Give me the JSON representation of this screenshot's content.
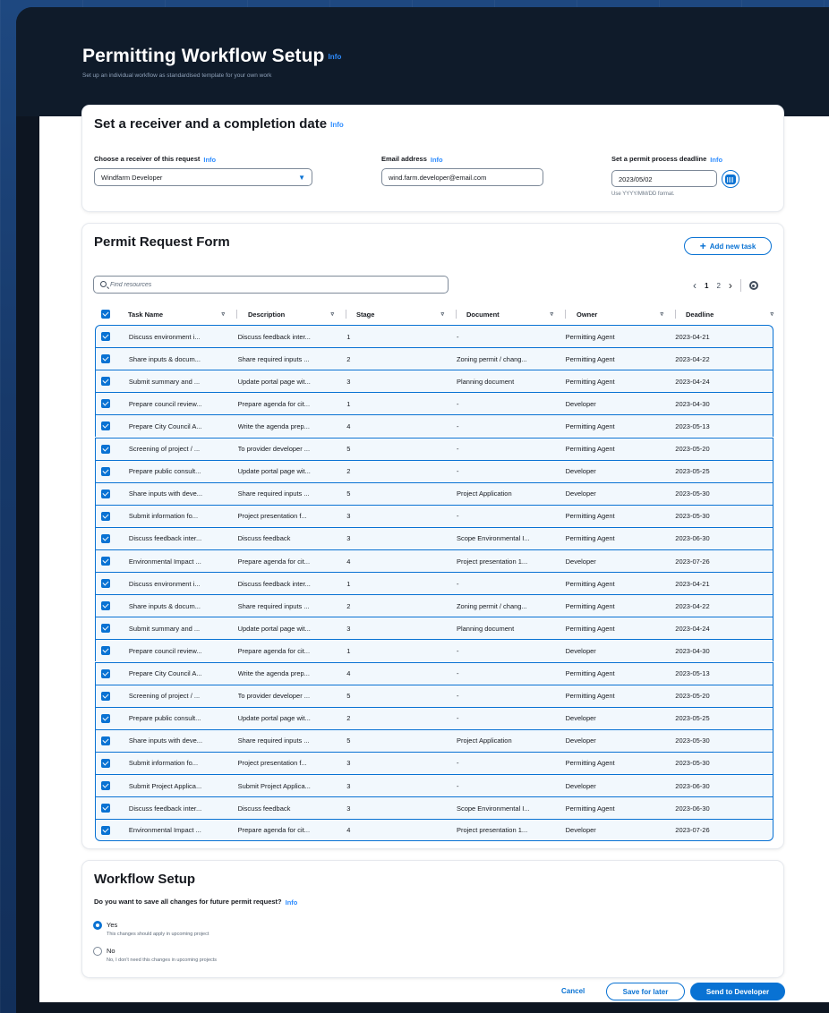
{
  "page": {
    "title": "Permitting Workflow Setup",
    "title_info": "Info",
    "subtitle": "Set up an individual workflow as standardised template for your own work"
  },
  "receiver_section": {
    "title": "Set a receiver and a completion date",
    "title_info": "Info",
    "receiver_label": "Choose a receiver of this request",
    "receiver_info": "Info",
    "receiver_value": "Windfarm Developer",
    "email_label": "Email address",
    "email_info": "Info",
    "email_value": "wind.farm.developer@email.com",
    "deadline_label": "Set a permit process deadline",
    "deadline_info": "Info",
    "deadline_value": "2023/05/02",
    "deadline_hint": "Use YYYY/MM/DD format."
  },
  "permit_form": {
    "title": "Permit Request Form",
    "add_task_label": "Add new task",
    "search_placeholder": "Find resources",
    "pagination": {
      "prev": "‹",
      "page1": "1",
      "page2": "2",
      "next": "›"
    },
    "columns": [
      "Task Name",
      "Description",
      "Stage",
      "Document",
      "Owner",
      "Deadline"
    ],
    "rows": [
      {
        "task": "Discuss environment i...",
        "desc": "Discuss feedback inter...",
        "stage": "1",
        "doc": "-",
        "owner": "Permitting Agent",
        "deadline": "2023-04-21"
      },
      {
        "task": "Share inputs & docum...",
        "desc": "Share required inputs ...",
        "stage": "2",
        "doc": "Zoning permit / chang...",
        "owner": "Permitting Agent",
        "deadline": "2023-04-22"
      },
      {
        "task": "Submit summary and ...",
        "desc": "Update portal page wit...",
        "stage": "3",
        "doc": "Planning document",
        "owner": "Permitting Agent",
        "deadline": "2023-04-24"
      },
      {
        "task": "Prepare council review...",
        "desc": "Prepare agenda for cit...",
        "stage": "1",
        "doc": "-",
        "owner": "Developer",
        "deadline": "2023-04-30"
      },
      {
        "task": "Prepare City Council A...",
        "desc": "Write the agenda prep...",
        "stage": "4",
        "doc": "-",
        "owner": "Permitting Agent",
        "deadline": "2023-05-13"
      },
      {
        "task": "Screening of project / ...",
        "desc": "To provider developer ...",
        "stage": "5",
        "doc": "-",
        "owner": "Permitting Agent",
        "deadline": "2023-05-20"
      },
      {
        "task": "Prepare public consult...",
        "desc": "Update portal page wit...",
        "stage": "2",
        "doc": "-",
        "owner": "Developer",
        "deadline": "2023-05-25"
      },
      {
        "task": "Share inputs with deve...",
        "desc": "Share required inputs ...",
        "stage": "5",
        "doc": "Project Application",
        "owner": "Developer",
        "deadline": "2023-05-30"
      },
      {
        "task": "Submit information fo...",
        "desc": "Project presentation f...",
        "stage": "3",
        "doc": "-",
        "owner": "Permitting Agent",
        "deadline": "2023-05-30"
      },
      {
        "task": "Discuss feedback inter...",
        "desc": "Discuss feedback",
        "stage": "3",
        "doc": "Scope Environmental I...",
        "owner": "Permitting Agent",
        "deadline": "2023-06-30"
      },
      {
        "task": "Environmental Impact ...",
        "desc": "Prepare agenda for cit...",
        "stage": "4",
        "doc": "Project presentation 1...",
        "owner": "Developer",
        "deadline": "2023-07-26"
      },
      {
        "task": "Discuss environment i...",
        "desc": "Discuss feedback inter...",
        "stage": "1",
        "doc": "-",
        "owner": "Permitting Agent",
        "deadline": "2023-04-21"
      },
      {
        "task": "Share inputs & docum...",
        "desc": "Share required inputs ...",
        "stage": "2",
        "doc": "Zoning permit / chang...",
        "owner": "Permitting Agent",
        "deadline": "2023-04-22"
      },
      {
        "task": "Submit summary and ...",
        "desc": "Update portal page wit...",
        "stage": "3",
        "doc": "Planning document",
        "owner": "Permitting Agent",
        "deadline": "2023-04-24"
      },
      {
        "task": "Prepare council review...",
        "desc": "Prepare agenda for cit...",
        "stage": "1",
        "doc": "-",
        "owner": "Developer",
        "deadline": "2023-04-30"
      },
      {
        "task": "Prepare City Council A...",
        "desc": "Write the agenda prep...",
        "stage": "4",
        "doc": "-",
        "owner": "Permitting Agent",
        "deadline": "2023-05-13"
      },
      {
        "task": "Screening of project / ...",
        "desc": "To provider developer ...",
        "stage": "5",
        "doc": "-",
        "owner": "Permitting Agent",
        "deadline": "2023-05-20"
      },
      {
        "task": "Prepare public consult...",
        "desc": "Update portal page wit...",
        "stage": "2",
        "doc": "-",
        "owner": "Developer",
        "deadline": "2023-05-25"
      },
      {
        "task": "Share inputs with deve...",
        "desc": "Share required inputs ...",
        "stage": "5",
        "doc": "Project Application",
        "owner": "Developer",
        "deadline": "2023-05-30"
      },
      {
        "task": "Submit information fo...",
        "desc": "Project presentation f...",
        "stage": "3",
        "doc": "-",
        "owner": "Permitting Agent",
        "deadline": "2023-05-30"
      },
      {
        "task": "Submit Project Applica...",
        "desc": "Submit Project Applica...",
        "stage": "3",
        "doc": "-",
        "owner": "Developer",
        "deadline": "2023-06-30"
      },
      {
        "task": "Discuss feedback inter...",
        "desc": "Discuss feedback",
        "stage": "3",
        "doc": "Scope Environmental I...",
        "owner": "Permitting Agent",
        "deadline": "2023-06-30"
      },
      {
        "task": "Environmental Impact ...",
        "desc": "Prepare agenda for cit...",
        "stage": "4",
        "doc": "Project presentation 1...",
        "owner": "Developer",
        "deadline": "2023-07-26"
      }
    ]
  },
  "workflow": {
    "title": "Workflow Setup",
    "question": "Do you want to save all changes for future permit request?",
    "question_info": "Info",
    "options": [
      {
        "label": "Yes",
        "desc": "This changes should apply in upcoming project",
        "selected": true
      },
      {
        "label": "No",
        "desc": "No, I don't need this changes in upcoming projects",
        "selected": false
      }
    ]
  },
  "footer": {
    "cancel": "Cancel",
    "save_later": "Save for later",
    "send": "Send to Developer"
  },
  "colors": {
    "accent": "#0972d3",
    "row_bg": "#f2f8fd",
    "dark_bg": "#0d1521"
  }
}
